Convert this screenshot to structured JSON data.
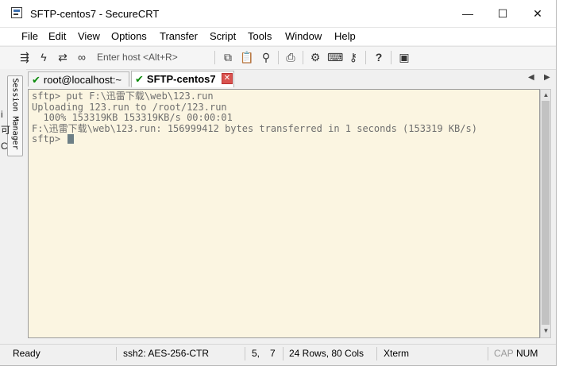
{
  "window": {
    "title": "SFTP-centos7 - SecureCRT",
    "minimize": "—",
    "maximize": "☐",
    "close": "✕"
  },
  "menu": [
    "File",
    "Edit",
    "View",
    "Options",
    "Transfer",
    "Script",
    "Tools",
    "Window",
    "Help"
  ],
  "toolbar": {
    "host_placeholder": "Enter host <Alt+R>",
    "icons": [
      "quick-connect-icon",
      "lightning-icon",
      "reconnect-icon",
      "link-icon",
      "copy-icon",
      "paste-icon",
      "find-icon",
      "print-icon",
      "settings-icon",
      "keymap-icon",
      "key-icon",
      "help-icon",
      "sftp-icon"
    ]
  },
  "session_manager": {
    "label": "Session Manager"
  },
  "tabs": [
    {
      "label": "root@localhost:~",
      "active": false
    },
    {
      "label": "SFTP-centos7",
      "active": true
    }
  ],
  "terminal": {
    "lines": [
      "sftp> put F:\\迅雷下载\\web\\123.run",
      "Uploading 123.run to /root/123.run",
      "  100% 153319KB 153319KB/s 00:00:01",
      "F:\\迅雷下载\\web\\123.run: 156999412 bytes transferred in 1 seconds (153319 KB/s)",
      "sftp> "
    ],
    "background": "#fbf5e1",
    "foreground": "#6e6e6e"
  },
  "status": {
    "ready": "Ready",
    "cipher": "ssh2: AES-256-CTR",
    "row": "5,",
    "col": "7",
    "size": "24 Rows, 80 Cols",
    "term": "Xterm",
    "cap": "CAP",
    "num": "NUM"
  },
  "background_text": [
    "i",
    "可",
    "C"
  ]
}
